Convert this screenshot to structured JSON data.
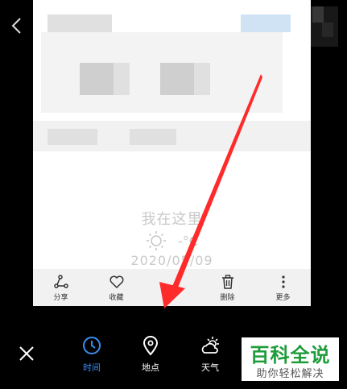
{
  "watermark_caption": {
    "location": "我在这里",
    "temperature": "-°C",
    "date": "2020/05/09"
  },
  "actions": [
    {
      "label": "分享",
      "icon": "share-icon"
    },
    {
      "label": "收藏",
      "icon": "heart-icon"
    },
    {
      "label": "",
      "icon": "pen-icon"
    },
    {
      "label": "删除",
      "icon": "trash-icon"
    },
    {
      "label": "更多",
      "icon": "more-icon"
    }
  ],
  "toolbar": {
    "tabs": [
      {
        "label": "时间",
        "icon": "clock-icon",
        "active": true
      },
      {
        "label": "地点",
        "icon": "location-pin-icon",
        "active": false
      },
      {
        "label": "天气",
        "icon": "weather-icon",
        "active": false
      }
    ]
  },
  "overlay_watermark": {
    "title": "百科全说",
    "subtitle": "助你轻松解决"
  },
  "colors": {
    "accent": "#3a8ff2",
    "arrow": "#ff2a2a",
    "watermark_green": "#1e9c3a"
  }
}
